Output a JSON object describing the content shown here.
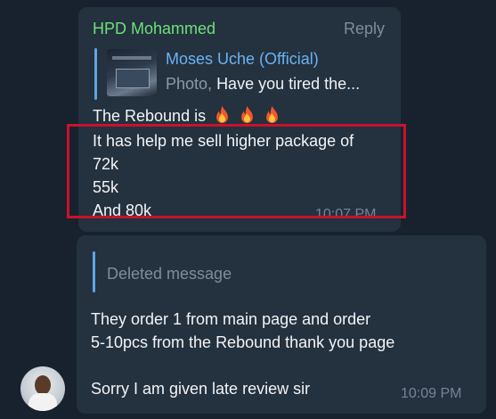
{
  "message1": {
    "sender": "HPD Mohammed",
    "reply_label": "Reply",
    "quote": {
      "author": "Moses Uche (Official)",
      "kind": "Photo,",
      "text": "Have you tired the..."
    },
    "lines": [
      "The Rebound is",
      "It has help me sell higher package of",
      "72k",
      "55k",
      "And 80k"
    ],
    "fire_count": 3,
    "time": "10:07 PM"
  },
  "message2": {
    "deleted_label": "Deleted message",
    "lines": [
      "They order 1 from main page and order",
      "5-10pcs from the Rebound thank you page",
      "Sorry I am given late review sir"
    ],
    "time": "10:09 PM"
  },
  "colors": {
    "background": "#18222e",
    "bubble": "#24313f",
    "sender_name": "#6ee07a",
    "quote_author": "#6ab3f3",
    "highlight_border": "#c9122c"
  }
}
